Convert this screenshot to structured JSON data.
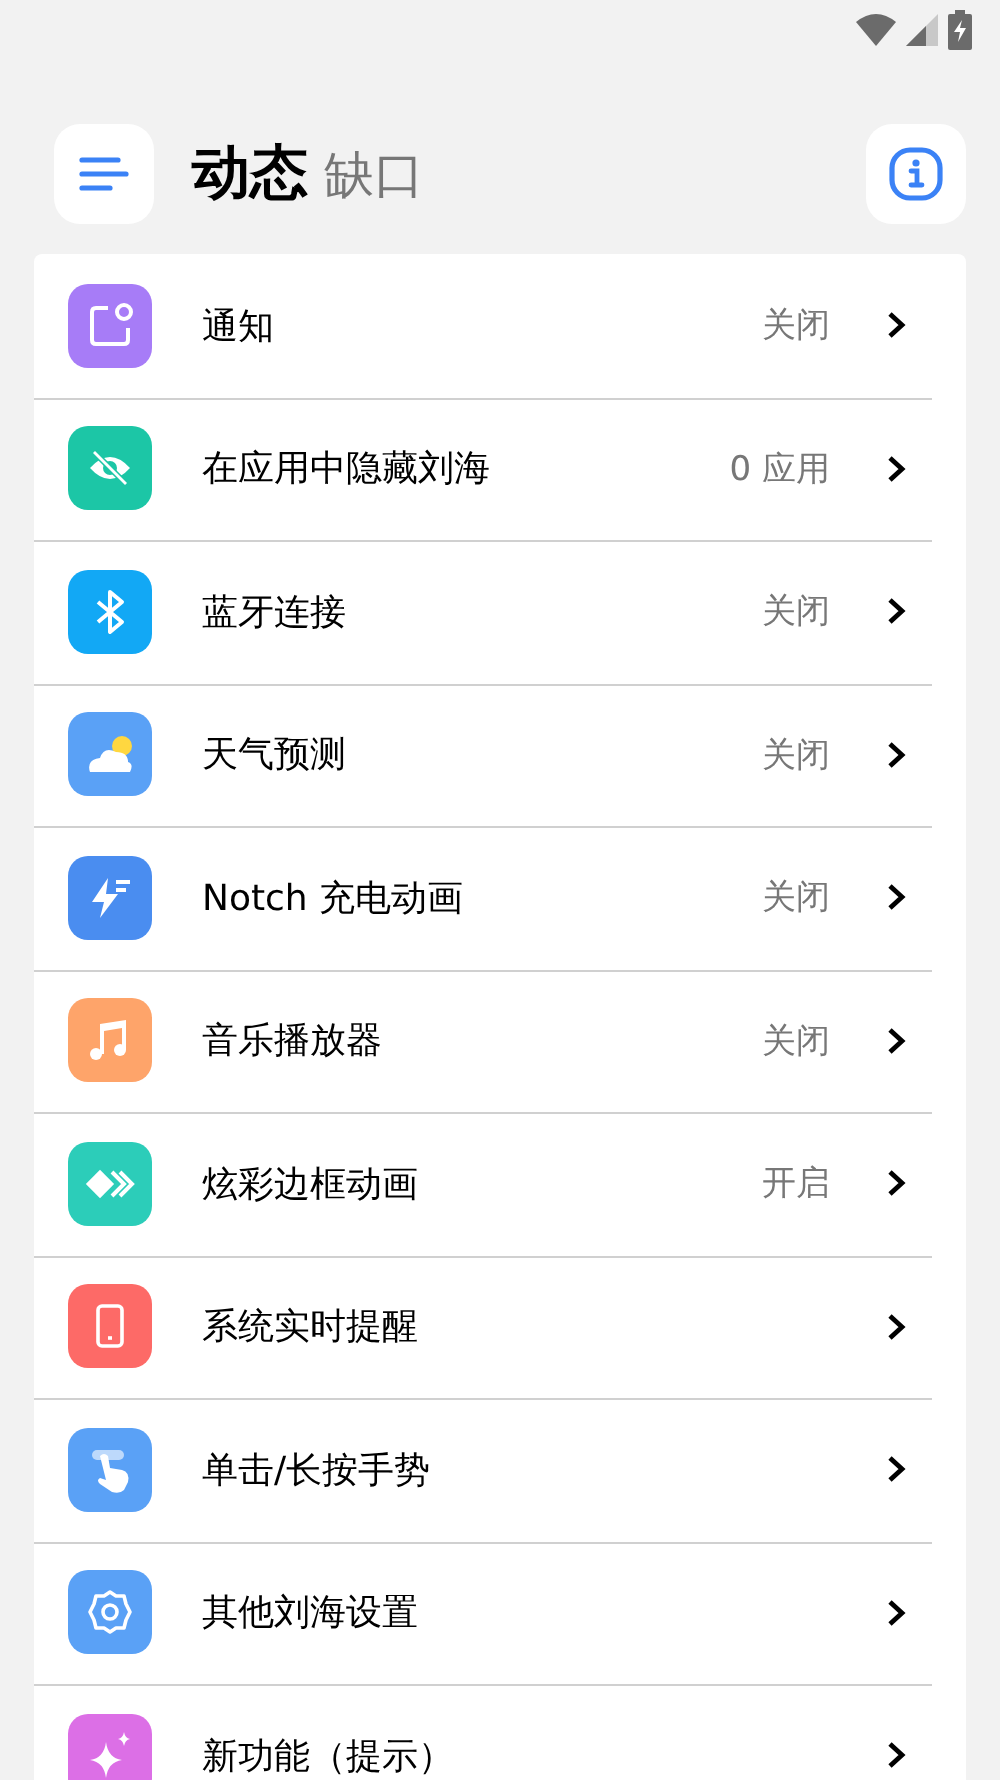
{
  "header": {
    "title": "动态",
    "subtitle": "缺口"
  },
  "items": [
    {
      "label": "通知",
      "status": "关闭",
      "color": "#a77cf7"
    },
    {
      "label": "在应用中隐藏刘海",
      "status": "0 应用",
      "color": "#1cc6a6"
    },
    {
      "label": "蓝牙连接",
      "status": "关闭",
      "color": "#12a8f5"
    },
    {
      "label": "天气预测",
      "status": "关闭",
      "color": "#5aa1f6"
    },
    {
      "label": "Notch 充电动画",
      "status": "关闭",
      "color": "#4a8df0"
    },
    {
      "label": "音乐播放器",
      "status": "关闭",
      "color": "#fea46a"
    },
    {
      "label": "炫彩边框动画",
      "status": "开启",
      "color": "#2ccdb9"
    },
    {
      "label": "系统实时提醒",
      "color": "#fd6a67"
    },
    {
      "label": "单击/长按手势",
      "color": "#5aa1f6"
    },
    {
      "label": "其他刘海设置",
      "color": "#5aa1f6"
    },
    {
      "label": "新功能（提示）",
      "color": "#dc6fe6"
    }
  ]
}
